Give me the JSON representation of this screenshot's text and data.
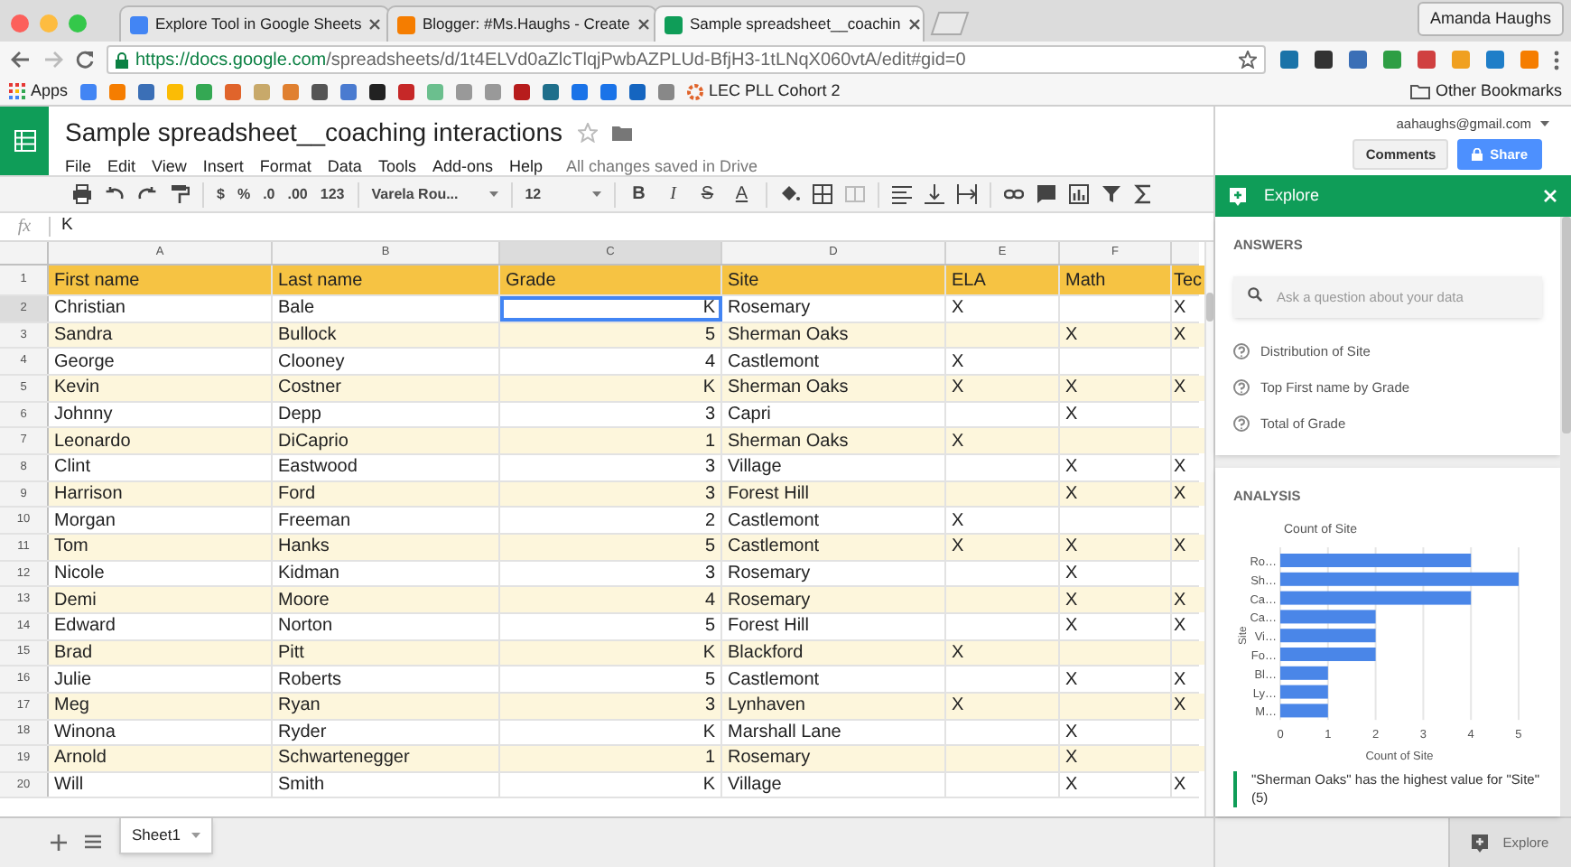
{
  "browser": {
    "tabs": [
      {
        "title": "Explore Tool in Google Sheets",
        "selected": false,
        "color": "#4285f4"
      },
      {
        "title": "Blogger: #Ms.Haughs - Create",
        "selected": false,
        "color": "#f57d00"
      },
      {
        "title": "Sample spreadsheet__coachin",
        "selected": true,
        "color": "#0f9d58"
      }
    ],
    "profile": "Amanda Haughs",
    "url_host": "https://docs.google.com",
    "url_path": "/spreadsheets/d/1t4ELVd0aZlcTlqjPwbAZPLUd-BfjH3-1tLNqX060vtA/edit#gid=0",
    "bookmarks": {
      "apps": "Apps",
      "folder": "LEC PLL Cohort 2",
      "other": "Other Bookmarks"
    }
  },
  "doc": {
    "title": "Sample spreadsheet__coaching interactions",
    "menu": [
      "File",
      "Edit",
      "View",
      "Insert",
      "Format",
      "Data",
      "Tools",
      "Add-ons",
      "Help"
    ],
    "save_status": "All changes saved in Drive",
    "account": "aahaughs@gmail.com",
    "comments": "Comments",
    "share": "Share"
  },
  "toolbar": {
    "number_formats": [
      "$",
      "%",
      ".0",
      ".00",
      "123"
    ],
    "font": "Varela Rou...",
    "size": "12",
    "text_styles": [
      "B",
      "I",
      "S",
      "A"
    ]
  },
  "formula": {
    "label": "fx",
    "value": "K"
  },
  "sheet": {
    "columns": [
      {
        "letter": "A",
        "selected": false
      },
      {
        "letter": "B",
        "selected": false
      },
      {
        "letter": "C",
        "selected": true
      },
      {
        "letter": "D",
        "selected": false
      },
      {
        "letter": "E",
        "selected": false
      },
      {
        "letter": "F",
        "selected": false
      }
    ],
    "rows": [
      {
        "number": "1",
        "selected": false,
        "cells": [
          "First name",
          "Last name",
          "Grade",
          "Site",
          "ELA",
          "Math",
          "Tec"
        ]
      },
      {
        "number": "2",
        "selected": true,
        "cells": [
          "Christian",
          "Bale",
          "K",
          "Rosemary",
          "X",
          "",
          "X"
        ]
      },
      {
        "number": "3",
        "selected": false,
        "cells": [
          "Sandra",
          "Bullock",
          "5",
          "Sherman Oaks",
          "",
          "X",
          "X"
        ]
      },
      {
        "number": "4",
        "selected": false,
        "cells": [
          "George",
          "Clooney",
          "4",
          "Castlemont",
          "X",
          "",
          ""
        ]
      },
      {
        "number": "5",
        "selected": false,
        "cells": [
          "Kevin",
          "Costner",
          "K",
          "Sherman Oaks",
          "X",
          "X",
          "X"
        ]
      },
      {
        "number": "6",
        "selected": false,
        "cells": [
          "Johnny",
          "Depp",
          "3",
          "Capri",
          "",
          "X",
          ""
        ]
      },
      {
        "number": "7",
        "selected": false,
        "cells": [
          "Leonardo",
          "DiCaprio",
          "1",
          "Sherman Oaks",
          "X",
          "",
          ""
        ]
      },
      {
        "number": "8",
        "selected": false,
        "cells": [
          "Clint",
          "Eastwood",
          "3",
          "Village",
          "",
          "X",
          "X"
        ]
      },
      {
        "number": "9",
        "selected": false,
        "cells": [
          "Harrison",
          "Ford",
          "3",
          "Forest Hill",
          "",
          "X",
          "X"
        ]
      },
      {
        "number": "10",
        "selected": false,
        "cells": [
          "Morgan",
          "Freeman",
          "2",
          "Castlemont",
          "X",
          "",
          ""
        ]
      },
      {
        "number": "11",
        "selected": false,
        "cells": [
          "Tom",
          "Hanks",
          "5",
          "Castlemont",
          "X",
          "X",
          "X"
        ]
      },
      {
        "number": "12",
        "selected": false,
        "cells": [
          "Nicole",
          "Kidman",
          "3",
          "Rosemary",
          "",
          "X",
          ""
        ]
      },
      {
        "number": "13",
        "selected": false,
        "cells": [
          "Demi",
          "Moore",
          "4",
          "Rosemary",
          "",
          "X",
          "X"
        ]
      },
      {
        "number": "14",
        "selected": false,
        "cells": [
          "Edward",
          "Norton",
          "5",
          "Forest Hill",
          "",
          "X",
          "X"
        ]
      },
      {
        "number": "15",
        "selected": false,
        "cells": [
          "Brad",
          "Pitt",
          "K",
          "Blackford",
          "X",
          "",
          ""
        ]
      },
      {
        "number": "16",
        "selected": false,
        "cells": [
          "Julie",
          "Roberts",
          "5",
          "Castlemont",
          "",
          "X",
          "X"
        ]
      },
      {
        "number": "17",
        "selected": false,
        "cells": [
          "Meg",
          "Ryan",
          "3",
          "Lynhaven",
          "X",
          "",
          "X"
        ]
      },
      {
        "number": "18",
        "selected": false,
        "cells": [
          "Winona",
          "Ryder",
          "K",
          "Marshall Lane",
          "",
          "X",
          ""
        ]
      },
      {
        "number": "19",
        "selected": false,
        "cells": [
          "Arnold",
          "Schwartenegger",
          "1",
          "Rosemary",
          "",
          "X",
          ""
        ]
      },
      {
        "number": "20",
        "selected": false,
        "cells": [
          "Will",
          "Smith",
          "K",
          "Village",
          "",
          "X",
          "X"
        ]
      }
    ],
    "tabs": [
      {
        "label": "Sheet1",
        "selected": true
      }
    ]
  },
  "explore": {
    "title": "Explore",
    "answers_heading": "ANSWERS",
    "search_placeholder": "Ask a question about your data",
    "suggestions": [
      "Distribution of Site",
      "Top First name by Grade",
      "Total of Grade"
    ],
    "analysis_heading": "ANALYSIS",
    "chart_data": {
      "type": "bar",
      "orientation": "horizontal",
      "title": "Count of Site",
      "xlabel": "Count of Site",
      "ylabel": "Site",
      "categories": [
        "Ro…",
        "Sh…",
        "Ca…",
        "Ca…",
        "Vi…",
        "Fo…",
        "Bl…",
        "Ly…",
        "M…"
      ],
      "series": [
        {
          "color": "#4a86e8",
          "values": [
            4,
            5,
            4,
            2,
            2,
            2,
            1,
            1,
            1
          ]
        }
      ],
      "xlim": [
        0,
        5
      ],
      "xticks": [
        0,
        1,
        2,
        3,
        4,
        5
      ],
      "grid": true
    },
    "insight": "\"Sherman Oaks\" has the highest value for \"Site\" (5)",
    "button": "Explore"
  }
}
